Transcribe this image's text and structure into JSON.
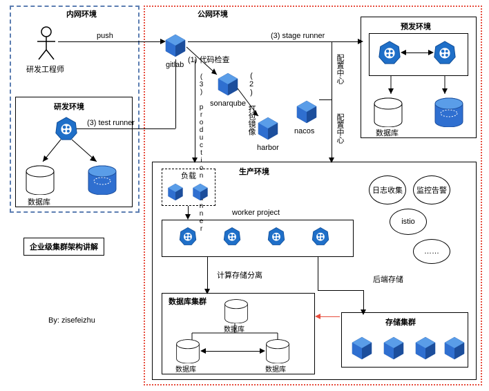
{
  "zones": {
    "intranet": "内网环境",
    "public": "公网环境"
  },
  "labels": {
    "push": "push",
    "engineer": "研发工程师",
    "gitlab": "gitlab",
    "codeCheck": "(1) 代码检查",
    "sonarqube": "sonarqube",
    "buildImage": "(2) 打包镜像",
    "harbor": "harbor",
    "nacos": "nacos",
    "stageRunner": "(3) stage runner",
    "testRunner": "(3) test runner",
    "prodRunner": "(3) production runner",
    "configCenter1": "配置中心",
    "configCenter2": "配置中心",
    "devEnv": "研发环境",
    "stageEnv": "预发环境",
    "prodEnv": "生产环境",
    "load": "负载",
    "workerProject": "worker project",
    "logCollect": "日志收集",
    "monitor": "监控告警",
    "istio": "istio",
    "etc": "……",
    "calcSep": "计算存储分离",
    "backendStorage": "后端存储",
    "dbCluster": "数据库集群",
    "storageCluster": "存储集群",
    "db": "数据库",
    "titleGuide": "企业级集群架构讲解",
    "author": "By: zisefeizhu"
  }
}
